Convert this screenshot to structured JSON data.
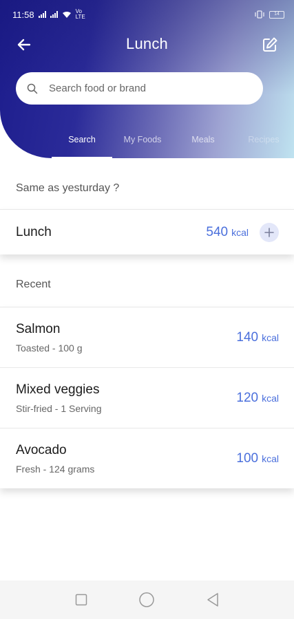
{
  "status_bar": {
    "time": "11:58",
    "network_label": "Vo LTE",
    "battery": "14"
  },
  "header": {
    "title": "Lunch",
    "back_icon": "arrow-left-icon",
    "edit_icon": "edit-icon",
    "colors": {
      "gradient_start": "#1c1c8c",
      "gradient_end": "#bfe3f0"
    }
  },
  "search": {
    "placeholder": "Search food or brand",
    "value": ""
  },
  "tabs": [
    {
      "label": "Search",
      "active": true
    },
    {
      "label": "My Foods",
      "active": false
    },
    {
      "label": "Meals",
      "active": false
    },
    {
      "label": "Recipes",
      "active": false
    }
  ],
  "same_as_yesterday": {
    "label": "Same as yesturday ?",
    "meal_name": "Lunch",
    "kcal": "540",
    "unit": "kcal"
  },
  "recent": {
    "label": "Recent",
    "items": [
      {
        "name": "Salmon",
        "detail": "Toasted - 100 g",
        "kcal": "140",
        "unit": "kcal"
      },
      {
        "name": "Mixed veggies",
        "detail": "Stir-fried - 1 Serving",
        "kcal": "120",
        "unit": "kcal"
      },
      {
        "name": "Avocado",
        "detail": "Fresh - 124 grams",
        "kcal": "100",
        "unit": "kcal"
      }
    ]
  },
  "accent_color": "#4a6fdc"
}
